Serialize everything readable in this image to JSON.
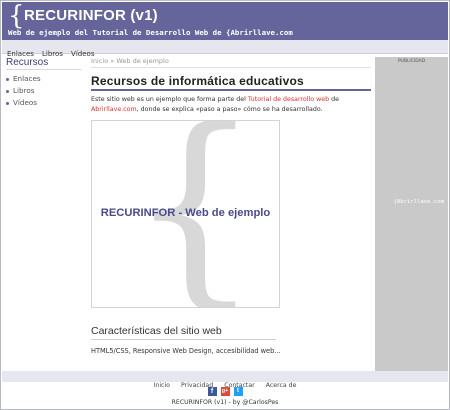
{
  "header": {
    "logo_glyph": "{",
    "title": "RECURINFOR (v1)",
    "subtitle": "Web de ejemplo del Tutorial de Desarrollo Web de {Abrirllave.com"
  },
  "topnav": {
    "items": [
      "Enlaces",
      "Libros",
      "Vídeos"
    ]
  },
  "sidebar": {
    "title": "Recursos",
    "items": [
      "Enlaces",
      "Libros",
      "Vídeos"
    ]
  },
  "breadcrumb": {
    "home": "Inicio",
    "separator": "»",
    "current": "Web de ejemplo"
  },
  "main": {
    "title": "Recursos de informática educativos",
    "intro_1": "Este sitio web es un ejemplo que forma parte del ",
    "intro_link1": "Tutorial de desarrollo web",
    "intro_2": " de ",
    "intro_link2": "Abrirllave.com",
    "intro_3": ", donde se explica «paso a paso» cómo se ha desarrollado.",
    "hero_text": "RECURINFOR - Web de ejemplo",
    "hero_glyph": "{",
    "section_title": "Características del sitio web",
    "section_text": "HTML5/CSS, Responsive Web Design, accesibilidad web..."
  },
  "ad": {
    "label": "PUBLICIDAD",
    "logo_text": "{Abrirllave.com"
  },
  "footer": {
    "links": [
      "Inicio",
      "Privacidad",
      "Contactar",
      "Acerca de"
    ],
    "social_icons": [
      "facebook-icon",
      "google-plus-icon",
      "twitter-icon"
    ],
    "social_glyphs": [
      "f",
      "g+",
      "t"
    ],
    "credit": "RECURINFOR (v1) - by @CarlosPes"
  },
  "colors": {
    "brand": "#65659b",
    "link": "#d9302b",
    "nav_bg": "#e6e6ee",
    "ad_bg": "#c9c9c9"
  }
}
